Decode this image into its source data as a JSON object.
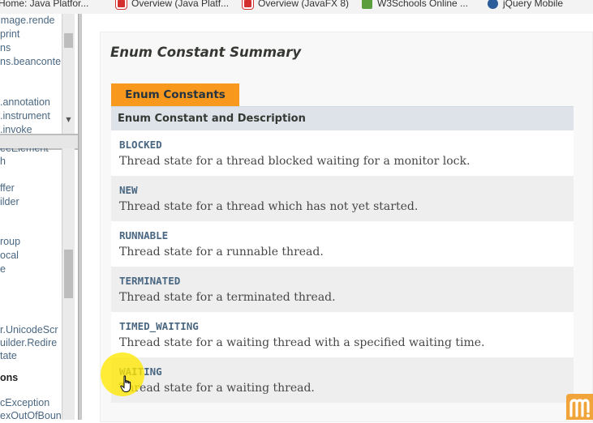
{
  "bookmarks": [
    {
      "label": "Home: Java Platfor...",
      "icon": "red-document-icon"
    },
    {
      "label": "Overview (Java Platf...",
      "icon": "red-document-icon"
    },
    {
      "label": "Overview (JavaFX 8)",
      "icon": "red-document-icon"
    },
    {
      "label": "W3Schools Online ...",
      "icon": "w3schools-icon"
    },
    {
      "label": "jQuery Mobile",
      "icon": "jquery-icon"
    }
  ],
  "packages_frame": {
    "items": [
      "image.rende",
      "print",
      "ns",
      "ns.beanconte",
      ".annotation",
      ".instrument",
      ".invoke"
    ]
  },
  "classes_frame": {
    "items": [
      "eeElement",
      "h",
      "ffer",
      "ilder",
      "roup",
      "ocal",
      "e",
      "r.UnicodeScr",
      "uilder.Redire",
      "tate",
      "ons",
      "cException",
      "exOutOfBoun"
    ]
  },
  "summary": {
    "title": "Enum Constant Summary",
    "caption": "Enum Constants",
    "header": "Enum Constant and Description",
    "rows": [
      {
        "name": "BLOCKED",
        "description": "Thread state for a thread blocked waiting for a monitor lock."
      },
      {
        "name": "NEW",
        "description": "Thread state for a thread which has not yet started."
      },
      {
        "name": "RUNNABLE",
        "description": "Thread state for a runnable thread."
      },
      {
        "name": "TERMINATED",
        "description": "Thread state for a terminated thread."
      },
      {
        "name": "TIMED_WAITING",
        "description": "Thread state for a waiting thread with a specified waiting time."
      },
      {
        "name": "WAITING",
        "description": "Thread state for a waiting thread."
      }
    ]
  },
  "colors": {
    "caption_tab": "#f8981d",
    "header_row": "#dee3e9",
    "link": "#4a6782",
    "cursor_highlight": "#ffe800",
    "watermark": "#f0a43a"
  }
}
